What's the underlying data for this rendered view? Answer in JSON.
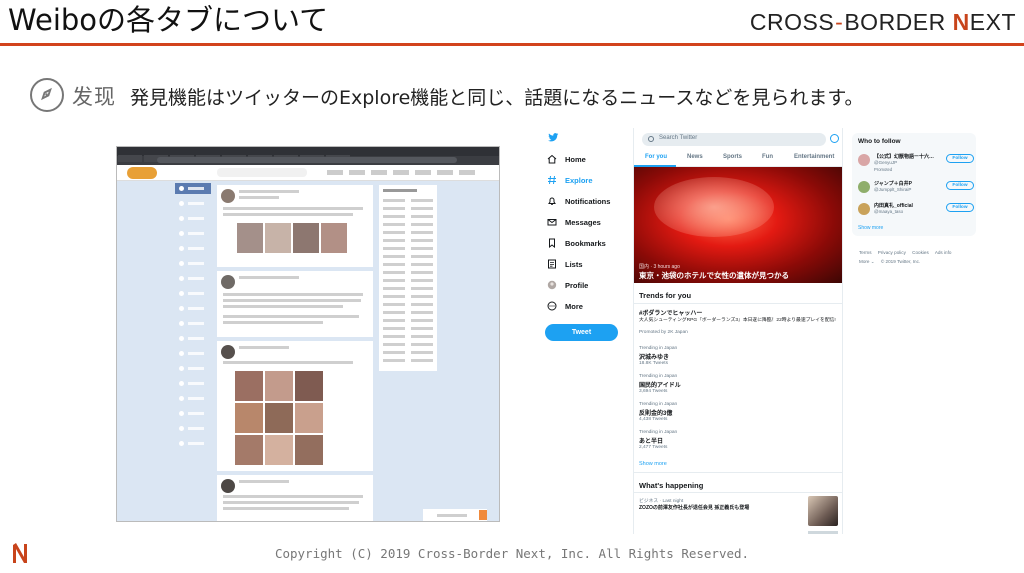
{
  "slide": {
    "title": "Weiboの各タブについて",
    "brand": {
      "left": "CROSS",
      "right": "BORDER",
      "next_n": "N",
      "next_rest": "EXT"
    },
    "feature_label": "发现",
    "feature_desc": "発見機能はツイッターのExplore機能と同じ、話題になるニュースなどを見られます。",
    "copyright": "Copyright (C) 2019 Cross-Border Next, Inc. All Rights Reserved.",
    "colors": {
      "accent": "#d2431c",
      "twitter_blue": "#1da1f2"
    }
  },
  "twitter": {
    "nav": [
      {
        "label": "Home",
        "icon": "home-icon"
      },
      {
        "label": "Explore",
        "icon": "hashtag-icon",
        "active": true
      },
      {
        "label": "Notifications",
        "icon": "bell-icon"
      },
      {
        "label": "Messages",
        "icon": "mail-icon"
      },
      {
        "label": "Bookmarks",
        "icon": "bookmark-icon"
      },
      {
        "label": "Lists",
        "icon": "list-icon"
      },
      {
        "label": "Profile",
        "icon": "avatar-icon"
      },
      {
        "label": "More",
        "icon": "more-icon"
      }
    ],
    "tweet_button": "Tweet",
    "search_placeholder": "Search Twitter",
    "tabs": [
      "For you",
      "News",
      "Sports",
      "Fun",
      "Entertainment"
    ],
    "hero": {
      "meta": "国内 · 3 hours ago",
      "headline": "東京・池袋のホテルで女性の遺体が見つかる"
    },
    "trends_title": "Trends for you",
    "promoted": {
      "tag": "#ボダランでヒャッハー",
      "desc": "大人気シューティングRPG『ボーダーランズ3』本日遂に降臨！22時より最速プレイを配信!",
      "by": "Promoted by 2K Japan"
    },
    "trends": [
      {
        "context": "Trending in Japan",
        "name": "沢城みゆき",
        "count": "18.8K Tweets"
      },
      {
        "context": "Trending in Japan",
        "name": "国民的アイドル",
        "count": "3,694 Tweets"
      },
      {
        "context": "Trending in Japan",
        "name": "反則金的3億",
        "count": "4,438 Tweets"
      },
      {
        "context": "Trending in Japan",
        "name": "あと半日",
        "count": "2,477 Tweets"
      }
    ],
    "show_more": "Show more",
    "happening": {
      "title": "What's happening",
      "meta": "ビジネス · Last night",
      "headline": "ZOZOの前澤友作社長が退任会見 孫正義氏も登場"
    },
    "who_to_follow": {
      "title": "Who to follow",
      "items": [
        {
          "name": "【公式】幻獣物語ー十六…",
          "handle": "@GenyuJP",
          "promoted": "Promoted",
          "button": "Follow",
          "avatar_color": "#d9a6a6"
        },
        {
          "name": "ジャンプ＋白井P",
          "handle": "@Jumpplt_ShiraiP",
          "button": "Follow",
          "avatar_color": "#8fae6b"
        },
        {
          "name": "内田真礼_official",
          "handle": "@maaya_taso",
          "button": "Follow",
          "avatar_color": "#c9a25a"
        }
      ],
      "show_more": "Show more"
    },
    "footer": {
      "links": [
        "Terms",
        "Privacy policy",
        "Cookies",
        "Ads info"
      ],
      "more": "More ⌄",
      "copyright": "© 2019 Twitter, Inc."
    }
  }
}
